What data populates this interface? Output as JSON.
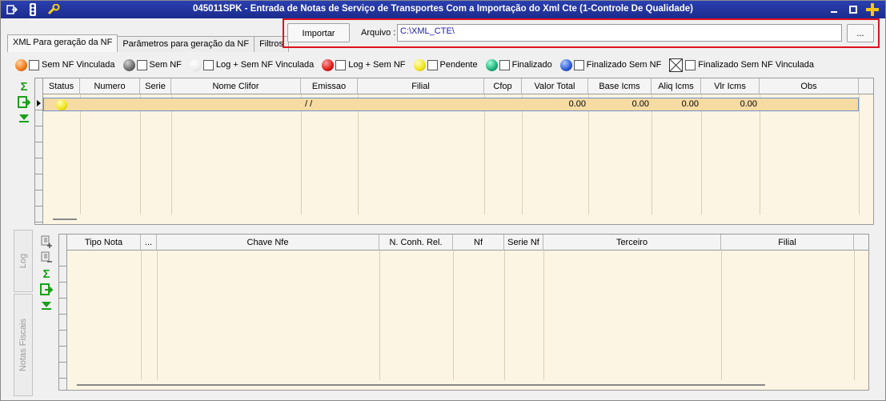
{
  "title": "045011SPK - Entrada de Notas de Serviço de Transportes Com a Importação do Xml Cte (1-Controle De Qualidade)",
  "tabs": [
    "XML Para geração da NF",
    "Parâmetros para geração da NF",
    "Filtros"
  ],
  "import": {
    "button": "Importar",
    "file_label": "Arquivo :",
    "file_value": "C:\\XML_CTE\\",
    "browse": "..."
  },
  "legend": [
    {
      "label": "Sem NF Vinculada",
      "color": "#f07a18"
    },
    {
      "label": "Sem NF",
      "color": "#6a6a6a"
    },
    {
      "label": "Log + Sem NF Vinculada",
      "color": "#ededed"
    },
    {
      "label": "Log + Sem NF",
      "color": "#e01818"
    },
    {
      "label": "Pendente",
      "color": "#f2e418"
    },
    {
      "label": "Finalizado",
      "color": "#1cb07a"
    },
    {
      "label": "Finalizado Sem NF",
      "color": "#2a5ad8"
    },
    {
      "label": "Finalizado Sem NF Vinculada",
      "color": "x"
    }
  ],
  "grid1": {
    "columns": [
      "Status",
      "Numero",
      "Serie",
      "Nome Clifor",
      "Emissao",
      "Filial",
      "Cfop",
      "Valor Total",
      "Base Icms",
      "Aliq Icms",
      "Vlr Icms",
      "Obs"
    ],
    "row": {
      "status_color": "#f2e418",
      "emissao": "/ /",
      "valor_total": "0.00",
      "base_icms": "0.00",
      "aliq_icms": "0.00",
      "vlr_icms": "0.00"
    }
  },
  "grid2": {
    "columns": [
      "Tipo Nota",
      "...",
      "Chave Nfe",
      "N. Conh. Rel.",
      "Nf",
      "Serie Nf",
      "Terceiro",
      "Filial"
    ]
  },
  "side_tabs": [
    "Log",
    "Notas Fiscais"
  ]
}
